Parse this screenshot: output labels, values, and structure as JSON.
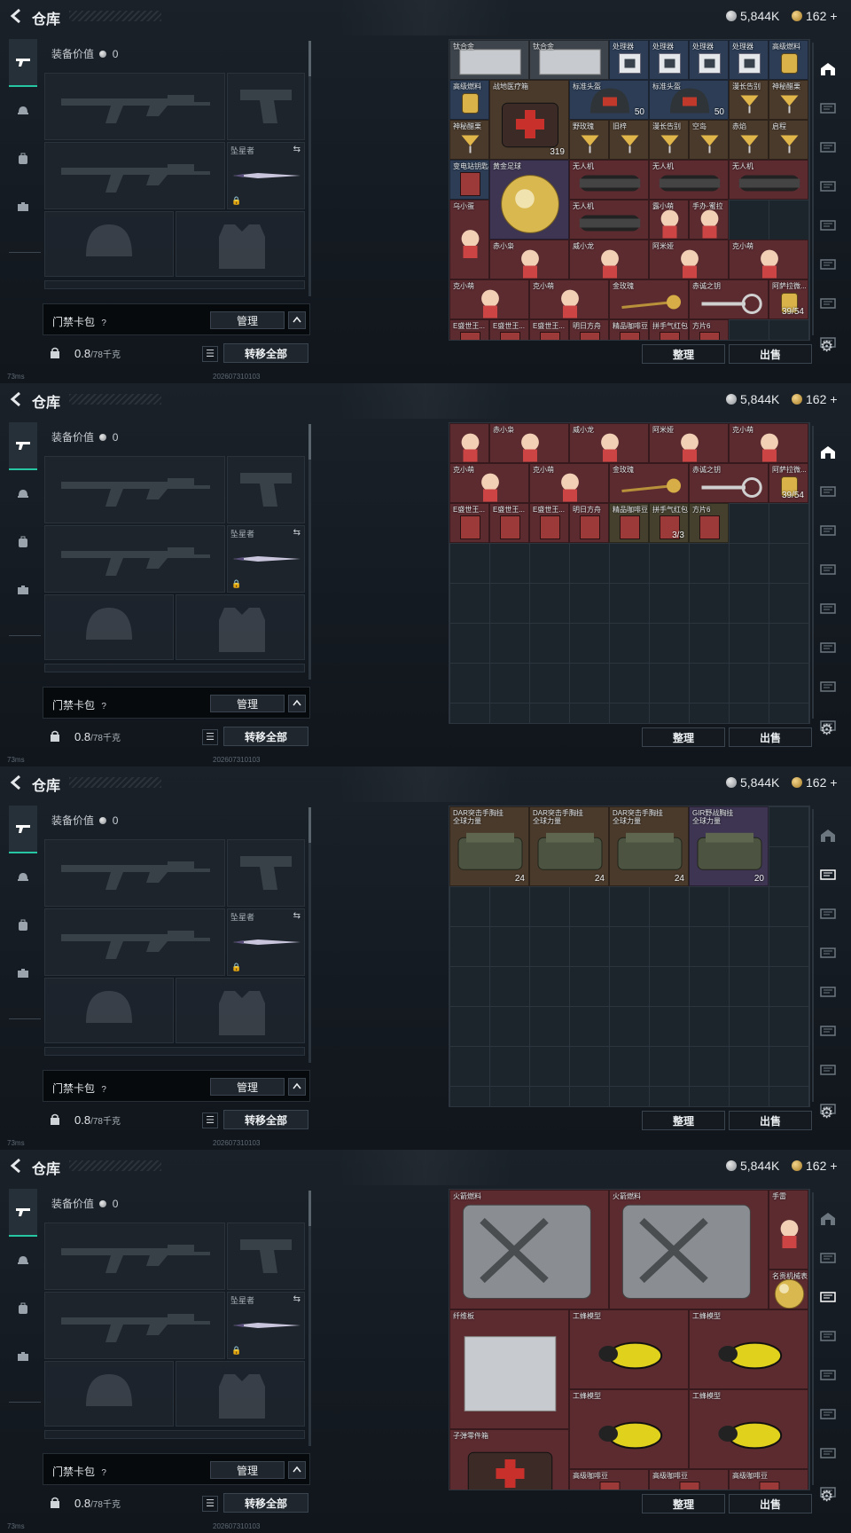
{
  "header": {
    "title": "仓库",
    "silver": "5,844K",
    "gold": "162",
    "gold_plus": "+"
  },
  "equip": {
    "value_label": "装备价值",
    "value": "0",
    "melee_name": "坠星者",
    "keybag_label": "门禁卡包",
    "help": "?",
    "manage": "管理",
    "weight": "0.8",
    "weight_max": "/78千克",
    "transfer_all": "转移全部"
  },
  "footer": {
    "ping": "73ms",
    "serial": "202607310103",
    "sort": "整理",
    "sell": "出售"
  },
  "screens": [
    {
      "active_storage_tab": 0,
      "items": [
        {
          "n": "钛合金",
          "c": 0,
          "r": 0,
          "w": 2,
          "h": 1,
          "bg": "bg-gray",
          "cnt": "",
          "art": "plate"
        },
        {
          "n": "钛合金",
          "c": 2,
          "r": 0,
          "w": 2,
          "h": 1,
          "bg": "bg-gray",
          "cnt": "",
          "art": "plate"
        },
        {
          "n": "处理器",
          "c": 4,
          "r": 0,
          "w": 1,
          "h": 1,
          "bg": "bg-blue",
          "cnt": "",
          "art": "chip"
        },
        {
          "n": "处理器",
          "c": 5,
          "r": 0,
          "w": 1,
          "h": 1,
          "bg": "bg-blue",
          "cnt": "",
          "art": "chip"
        },
        {
          "n": "处理器",
          "c": 6,
          "r": 0,
          "w": 1,
          "h": 1,
          "bg": "bg-blue",
          "cnt": "",
          "art": "chip"
        },
        {
          "n": "处理器",
          "c": 7,
          "r": 0,
          "w": 1,
          "h": 1,
          "bg": "bg-blue",
          "cnt": "",
          "art": "chip"
        },
        {
          "n": "高级燃料",
          "c": 8,
          "r": 0,
          "w": 1,
          "h": 1,
          "bg": "bg-blue",
          "cnt": "",
          "art": "jar"
        },
        {
          "n": "高级燃料",
          "c": 0,
          "r": 1,
          "w": 1,
          "h": 1,
          "bg": "bg-blue",
          "cnt": "",
          "art": "jar"
        },
        {
          "n": "战地医疗箱",
          "c": 1,
          "r": 1,
          "w": 2,
          "h": 2,
          "bg": "bg-brown",
          "cnt": "319",
          "art": "medkit"
        },
        {
          "n": "标准头盔",
          "c": 3,
          "r": 1,
          "w": 2,
          "h": 1,
          "bg": "bg-blue",
          "cnt": "50",
          "art": "helmet"
        },
        {
          "n": "标准头盔",
          "c": 5,
          "r": 1,
          "w": 2,
          "h": 1,
          "bg": "bg-blue",
          "cnt": "50",
          "art": "helmet"
        },
        {
          "n": "漫长告别",
          "c": 7,
          "r": 1,
          "w": 1,
          "h": 1,
          "bg": "bg-brown",
          "cnt": "",
          "art": "cocktail"
        },
        {
          "n": "神秘醋栗",
          "c": 8,
          "r": 1,
          "w": 1,
          "h": 1,
          "bg": "bg-brown",
          "cnt": "",
          "art": "cocktail"
        },
        {
          "n": "神秘醋栗",
          "c": 0,
          "r": 2,
          "w": 1,
          "h": 1,
          "bg": "bg-brown",
          "cnt": "",
          "art": "cocktail"
        },
        {
          "n": "野玫瑰",
          "c": 3,
          "r": 2,
          "w": 1,
          "h": 1,
          "bg": "bg-brown",
          "cnt": "",
          "art": "cocktail"
        },
        {
          "n": "旧梓",
          "c": 4,
          "r": 2,
          "w": 1,
          "h": 1,
          "bg": "bg-brown",
          "cnt": "",
          "art": "cocktail"
        },
        {
          "n": "漫长告别",
          "c": 5,
          "r": 2,
          "w": 1,
          "h": 1,
          "bg": "bg-brown",
          "cnt": "",
          "art": "cocktail"
        },
        {
          "n": "空岛",
          "c": 6,
          "r": 2,
          "w": 1,
          "h": 1,
          "bg": "bg-brown",
          "cnt": "",
          "art": "cocktail"
        },
        {
          "n": "赤焰",
          "c": 7,
          "r": 2,
          "w": 1,
          "h": 1,
          "bg": "bg-brown",
          "cnt": "",
          "art": "cocktail"
        },
        {
          "n": "启程",
          "c": 8,
          "r": 2,
          "w": 1,
          "h": 1,
          "bg": "bg-brown",
          "cnt": "",
          "art": "cocktail"
        },
        {
          "n": "变电站钥匙",
          "c": 0,
          "r": 3,
          "w": 1,
          "h": 1,
          "bg": "bg-blue",
          "cnt": "",
          "art": "card"
        },
        {
          "n": "黄金足球",
          "c": 1,
          "r": 3,
          "w": 2,
          "h": 2,
          "bg": "bg-purple",
          "cnt": "",
          "art": "ball"
        },
        {
          "n": "无人机",
          "c": 3,
          "r": 3,
          "w": 2,
          "h": 1,
          "bg": "bg-red",
          "cnt": "",
          "art": "roller"
        },
        {
          "n": "无人机",
          "c": 5,
          "r": 3,
          "w": 2,
          "h": 1,
          "bg": "bg-red",
          "cnt": "",
          "art": "roller"
        },
        {
          "n": "无人机",
          "c": 7,
          "r": 3,
          "w": 2,
          "h": 1,
          "bg": "bg-red",
          "cnt": "",
          "art": "roller"
        },
        {
          "n": "乌小蛋",
          "c": 0,
          "r": 4,
          "w": 1,
          "h": 2,
          "bg": "bg-red",
          "cnt": "",
          "art": "figure"
        },
        {
          "n": "无人机",
          "c": 3,
          "r": 4,
          "w": 2,
          "h": 1,
          "bg": "bg-red",
          "cnt": "",
          "art": "roller"
        },
        {
          "n": "露小萌",
          "c": 5,
          "r": 4,
          "w": 1,
          "h": 1,
          "bg": "bg-red",
          "cnt": "",
          "art": "figure"
        },
        {
          "n": "手办·蜜拉",
          "c": 6,
          "r": 4,
          "w": 1,
          "h": 1,
          "bg": "bg-red",
          "cnt": "",
          "art": "figure"
        },
        {
          "n": "赤小枭",
          "c": 1,
          "r": 5,
          "w": 2,
          "h": 1,
          "bg": "bg-red",
          "cnt": "",
          "art": "figure"
        },
        {
          "n": "威小龙",
          "c": 3,
          "r": 5,
          "w": 2,
          "h": 1,
          "bg": "bg-red",
          "cnt": "",
          "art": "figure"
        },
        {
          "n": "阿米娅",
          "c": 5,
          "r": 5,
          "w": 2,
          "h": 1,
          "bg": "bg-red",
          "cnt": "",
          "art": "figure"
        },
        {
          "n": "克小萌",
          "c": 7,
          "r": 5,
          "w": 2,
          "h": 1,
          "bg": "bg-red",
          "cnt": "",
          "art": "figure"
        },
        {
          "n": "克小萌",
          "c": 0,
          "r": 6,
          "w": 2,
          "h": 1,
          "bg": "bg-red",
          "cnt": "",
          "art": "figure"
        },
        {
          "n": "克小萌",
          "c": 2,
          "r": 6,
          "w": 2,
          "h": 1,
          "bg": "bg-red",
          "cnt": "",
          "art": "figure"
        },
        {
          "n": "金玫瑰",
          "c": 4,
          "r": 6,
          "w": 2,
          "h": 1,
          "bg": "bg-red",
          "cnt": "",
          "art": "rose"
        },
        {
          "n": "赤诚之钥",
          "c": 6,
          "r": 6,
          "w": 2,
          "h": 1,
          "bg": "bg-red",
          "cnt": "",
          "art": "key"
        },
        {
          "n": "阿萨拉微...",
          "c": 8,
          "r": 6,
          "w": 1,
          "h": 1,
          "bg": "bg-red",
          "cnt": "39/54",
          "art": "jar"
        },
        {
          "n": "E盛世王...",
          "c": 0,
          "r": 7,
          "w": 1,
          "h": 1,
          "bg": "bg-red",
          "cnt": "",
          "art": "card"
        },
        {
          "n": "E盛世王...",
          "c": 1,
          "r": 7,
          "w": 1,
          "h": 1,
          "bg": "bg-red",
          "cnt": "",
          "art": "card"
        },
        {
          "n": "E盛世王...",
          "c": 2,
          "r": 7,
          "w": 1,
          "h": 1,
          "bg": "bg-red",
          "cnt": "",
          "art": "card"
        },
        {
          "n": "明日方舟",
          "c": 3,
          "r": 7,
          "w": 1,
          "h": 1,
          "bg": "bg-red",
          "cnt": "",
          "art": "card"
        },
        {
          "n": "精品咖啡豆",
          "c": 4,
          "r": 7,
          "w": 1,
          "h": 1,
          "bg": "bg-red",
          "cnt": "",
          "art": "card"
        },
        {
          "n": "拼手气红包",
          "c": 5,
          "r": 7,
          "w": 1,
          "h": 1,
          "bg": "bg-red",
          "cnt": "",
          "art": "card"
        },
        {
          "n": "方片6",
          "c": 6,
          "r": 7,
          "w": 1,
          "h": 1,
          "bg": "bg-red",
          "cnt": "",
          "art": "card"
        }
      ]
    },
    {
      "active_storage_tab": 0,
      "items": [
        {
          "n": "赤小枭",
          "c": 1,
          "r": 0,
          "w": 2,
          "h": 1,
          "bg": "bg-red",
          "cnt": "",
          "art": "figure"
        },
        {
          "n": "威小龙",
          "c": 3,
          "r": 0,
          "w": 2,
          "h": 1,
          "bg": "bg-red",
          "cnt": "",
          "art": "figure"
        },
        {
          "n": "阿米娅",
          "c": 5,
          "r": 0,
          "w": 2,
          "h": 1,
          "bg": "bg-red",
          "cnt": "",
          "art": "figure"
        },
        {
          "n": "克小萌",
          "c": 7,
          "r": 0,
          "w": 2,
          "h": 1,
          "bg": "bg-red",
          "cnt": "",
          "art": "figure"
        },
        {
          "n": "",
          "c": 0,
          "r": 0,
          "w": 1,
          "h": 1,
          "bg": "bg-red",
          "cnt": "",
          "art": "figure"
        },
        {
          "n": "克小萌",
          "c": 0,
          "r": 1,
          "w": 2,
          "h": 1,
          "bg": "bg-red",
          "cnt": "",
          "art": "figure"
        },
        {
          "n": "克小萌",
          "c": 2,
          "r": 1,
          "w": 2,
          "h": 1,
          "bg": "bg-red",
          "cnt": "",
          "art": "figure"
        },
        {
          "n": "金玫瑰",
          "c": 4,
          "r": 1,
          "w": 2,
          "h": 1,
          "bg": "bg-red",
          "cnt": "",
          "art": "rose"
        },
        {
          "n": "赤诚之钥",
          "c": 6,
          "r": 1,
          "w": 2,
          "h": 1,
          "bg": "bg-red",
          "cnt": "",
          "art": "key"
        },
        {
          "n": "阿萨拉微...",
          "c": 8,
          "r": 1,
          "w": 1,
          "h": 1,
          "bg": "bg-red",
          "cnt": "39/54",
          "art": "jar"
        },
        {
          "n": "E盛世王...",
          "c": 0,
          "r": 2,
          "w": 1,
          "h": 1,
          "bg": "bg-red",
          "cnt": "",
          "art": "card"
        },
        {
          "n": "E盛世王...",
          "c": 1,
          "r": 2,
          "w": 1,
          "h": 1,
          "bg": "bg-red",
          "cnt": "",
          "art": "card"
        },
        {
          "n": "E盛世王...",
          "c": 2,
          "r": 2,
          "w": 1,
          "h": 1,
          "bg": "bg-red",
          "cnt": "",
          "art": "card"
        },
        {
          "n": "明日方舟",
          "c": 3,
          "r": 2,
          "w": 1,
          "h": 1,
          "bg": "bg-red",
          "cnt": "",
          "art": "card"
        },
        {
          "n": "精品咖啡豆",
          "c": 4,
          "r": 2,
          "w": 1,
          "h": 1,
          "bg": "bg-olive",
          "cnt": "",
          "art": "card"
        },
        {
          "n": "拼手气红包",
          "c": 5,
          "r": 2,
          "w": 1,
          "h": 1,
          "bg": "bg-olive",
          "cnt": "3/3",
          "art": "card"
        },
        {
          "n": "方片6",
          "c": 6,
          "r": 2,
          "w": 1,
          "h": 1,
          "bg": "bg-olive",
          "cnt": "",
          "art": "card"
        }
      ]
    },
    {
      "active_storage_tab": 1,
      "items": [
        {
          "n": "DAR突击手胸挂\n全球力量",
          "c": 0,
          "r": 0,
          "w": 2,
          "h": 2,
          "bg": "bg-brown",
          "cnt": "24",
          "art": "vest"
        },
        {
          "n": "DAR突击手胸挂\n全球力量",
          "c": 2,
          "r": 0,
          "w": 2,
          "h": 2,
          "bg": "bg-brown",
          "cnt": "24",
          "art": "vest"
        },
        {
          "n": "DAR突击手胸挂\n全球力量",
          "c": 4,
          "r": 0,
          "w": 2,
          "h": 2,
          "bg": "bg-brown",
          "cnt": "24",
          "art": "vest"
        },
        {
          "n": "GIR野战胸挂\n全球力量",
          "c": 6,
          "r": 0,
          "w": 2,
          "h": 2,
          "bg": "bg-purple",
          "cnt": "20",
          "art": "vest"
        }
      ]
    },
    {
      "active_storage_tab": 2,
      "items": [
        {
          "n": "火箭燃料",
          "c": 0,
          "r": 0,
          "w": 4,
          "h": 3,
          "bg": "bg-red",
          "cnt": "",
          "art": "can"
        },
        {
          "n": "火箭燃料",
          "c": 4,
          "r": 0,
          "w": 4,
          "h": 3,
          "bg": "bg-red",
          "cnt": "",
          "art": "can"
        },
        {
          "n": "手雷",
          "c": 8,
          "r": 0,
          "w": 1,
          "h": 2,
          "bg": "bg-red",
          "cnt": "",
          "art": "figure"
        },
        {
          "n": "名贵机械表",
          "c": 8,
          "r": 2,
          "w": 1,
          "h": 1,
          "bg": "bg-red",
          "cnt": "",
          "art": "ball"
        },
        {
          "n": "纤维板",
          "c": 0,
          "r": 3,
          "w": 3,
          "h": 3,
          "bg": "bg-red",
          "cnt": "",
          "art": "plate"
        },
        {
          "n": "工蜂模型",
          "c": 3,
          "r": 3,
          "w": 3,
          "h": 2,
          "bg": "bg-red",
          "cnt": "",
          "art": "bee"
        },
        {
          "n": "工蜂模型",
          "c": 6,
          "r": 3,
          "w": 3,
          "h": 2,
          "bg": "bg-red",
          "cnt": "",
          "art": "bee"
        },
        {
          "n": "工蜂模型",
          "c": 3,
          "r": 5,
          "w": 3,
          "h": 2,
          "bg": "bg-red",
          "cnt": "",
          "art": "bee"
        },
        {
          "n": "工蜂模型",
          "c": 6,
          "r": 5,
          "w": 3,
          "h": 2,
          "bg": "bg-red",
          "cnt": "",
          "art": "bee"
        },
        {
          "n": "子弹零件箱",
          "c": 0,
          "r": 6,
          "w": 3,
          "h": 2,
          "bg": "bg-red",
          "cnt": "",
          "art": "medkit"
        },
        {
          "n": "高级咖啡豆",
          "c": 3,
          "r": 7,
          "w": 2,
          "h": 1,
          "bg": "bg-red",
          "cnt": "",
          "art": "card"
        },
        {
          "n": "高级咖啡豆",
          "c": 5,
          "r": 7,
          "w": 2,
          "h": 1,
          "bg": "bg-red",
          "cnt": "",
          "art": "card"
        },
        {
          "n": "高级咖啡豆",
          "c": 7,
          "r": 7,
          "w": 2,
          "h": 1,
          "bg": "bg-red",
          "cnt": "",
          "art": "card"
        }
      ]
    }
  ],
  "icons": {
    "back": "back-arrow-icon",
    "nav": [
      "gun-icon",
      "helmet-icon",
      "backpack-icon",
      "case-icon"
    ],
    "storage_tabs": [
      "warehouse-icon",
      "storage-ext-1-icon",
      "storage-ext-2-icon",
      "storage-ext-3-icon",
      "storage-ext-4-icon",
      "storage-ext-5-icon",
      "storage-ext-6-icon",
      "storage-ext-7-icon"
    ]
  }
}
